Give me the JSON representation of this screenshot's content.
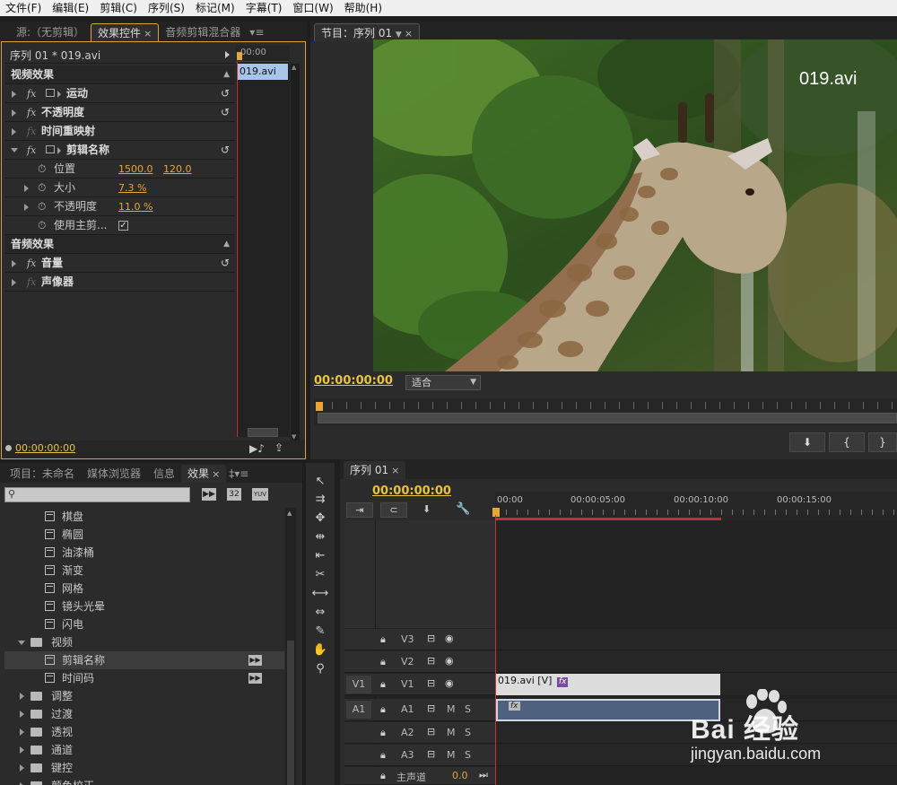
{
  "menubar": [
    "文件(F)",
    "编辑(E)",
    "剪辑(C)",
    "序列(S)",
    "标记(M)",
    "字幕(T)",
    "窗口(W)",
    "帮助(H)"
  ],
  "source_panel": {
    "tabs": {
      "source": "源:（无剪辑）",
      "effect_controls": "效果控件",
      "audio_mixer": "音频剪辑混合器"
    },
    "sequence_clip": "序列 01 * 019.avi",
    "ruler_time": "00:00",
    "clip_name": "019.avi",
    "video_effects_header": "视频效果",
    "audio_effects_header": "音频效果",
    "fx_label": "fx",
    "effects": [
      {
        "name": "运动"
      },
      {
        "name": "不透明度"
      },
      {
        "name": "时间重映射"
      },
      {
        "name": "剪辑名称"
      }
    ],
    "params": {
      "position_label": "位置",
      "position_x": "1500.0",
      "position_y": "120.0",
      "size_label": "大小",
      "size_value": "7.3 %",
      "opacity_label": "不透明度",
      "opacity_value": "11.0 %",
      "use_master_label": "使用主剪..."
    },
    "audio_effects": [
      {
        "name": "音量"
      },
      {
        "name": "声像器"
      }
    ],
    "timecode": "00:00:00:00"
  },
  "program_panel": {
    "tab": "节目：序列 01",
    "overlay_text": "019.avi",
    "timecode": "00:00:00:00",
    "fit_value": "适合"
  },
  "project_panel": {
    "tabs": {
      "project": "项目：未命名",
      "media_browser": "媒体浏览器",
      "info": "信息",
      "effects": "效果"
    },
    "search_placeholder": "",
    "icons": [
      "32",
      "YUV"
    ],
    "items": [
      {
        "label": "棋盘",
        "indent": 2,
        "type": "file"
      },
      {
        "label": "椭圆",
        "indent": 2,
        "type": "file"
      },
      {
        "label": "油漆桶",
        "indent": 2,
        "type": "file"
      },
      {
        "label": "渐变",
        "indent": 2,
        "type": "file"
      },
      {
        "label": "网格",
        "indent": 2,
        "type": "file"
      },
      {
        "label": "镜头光晕",
        "indent": 2,
        "type": "file"
      },
      {
        "label": "闪电",
        "indent": 2,
        "type": "file"
      },
      {
        "label": "视频",
        "indent": 1,
        "type": "folder-open"
      },
      {
        "label": "剪辑名称",
        "indent": 2,
        "type": "file",
        "badge": true,
        "selected": true
      },
      {
        "label": "时间码",
        "indent": 2,
        "type": "file",
        "badge": true
      },
      {
        "label": "调整",
        "indent": 1,
        "type": "folder"
      },
      {
        "label": "过渡",
        "indent": 1,
        "type": "folder"
      },
      {
        "label": "透视",
        "indent": 1,
        "type": "folder"
      },
      {
        "label": "通道",
        "indent": 1,
        "type": "folder"
      },
      {
        "label": "键控",
        "indent": 1,
        "type": "folder"
      },
      {
        "label": "颜色校正",
        "indent": 1,
        "type": "folder"
      }
    ]
  },
  "timeline": {
    "tab": "序列 01",
    "timecode": "00:00:00:00",
    "ruler": [
      "00:00",
      "00:00:05:00",
      "00:00:10:00",
      "00:00:15:00"
    ],
    "tracks": {
      "v3": "V3",
      "v2": "V2",
      "v1": "V1",
      "v1_src": "V1",
      "a1": "A1",
      "a1_src": "A1",
      "a2": "A2",
      "a3": "A3",
      "master": "主声道",
      "master_value": "0.0",
      "m": "M",
      "s": "S"
    },
    "video_clip": "019.avi [V]",
    "fx_badge": "fx"
  },
  "watermark": {
    "text": "Bai 经验",
    "url": "jingyan.baidu.com"
  },
  "colors": {
    "accent_timecode": "#e8c240",
    "playhead": "#e03030",
    "clip_video": "#dcdcdc",
    "clip_audio": "#4e6280",
    "selected_clip": "#a8c4e8"
  }
}
